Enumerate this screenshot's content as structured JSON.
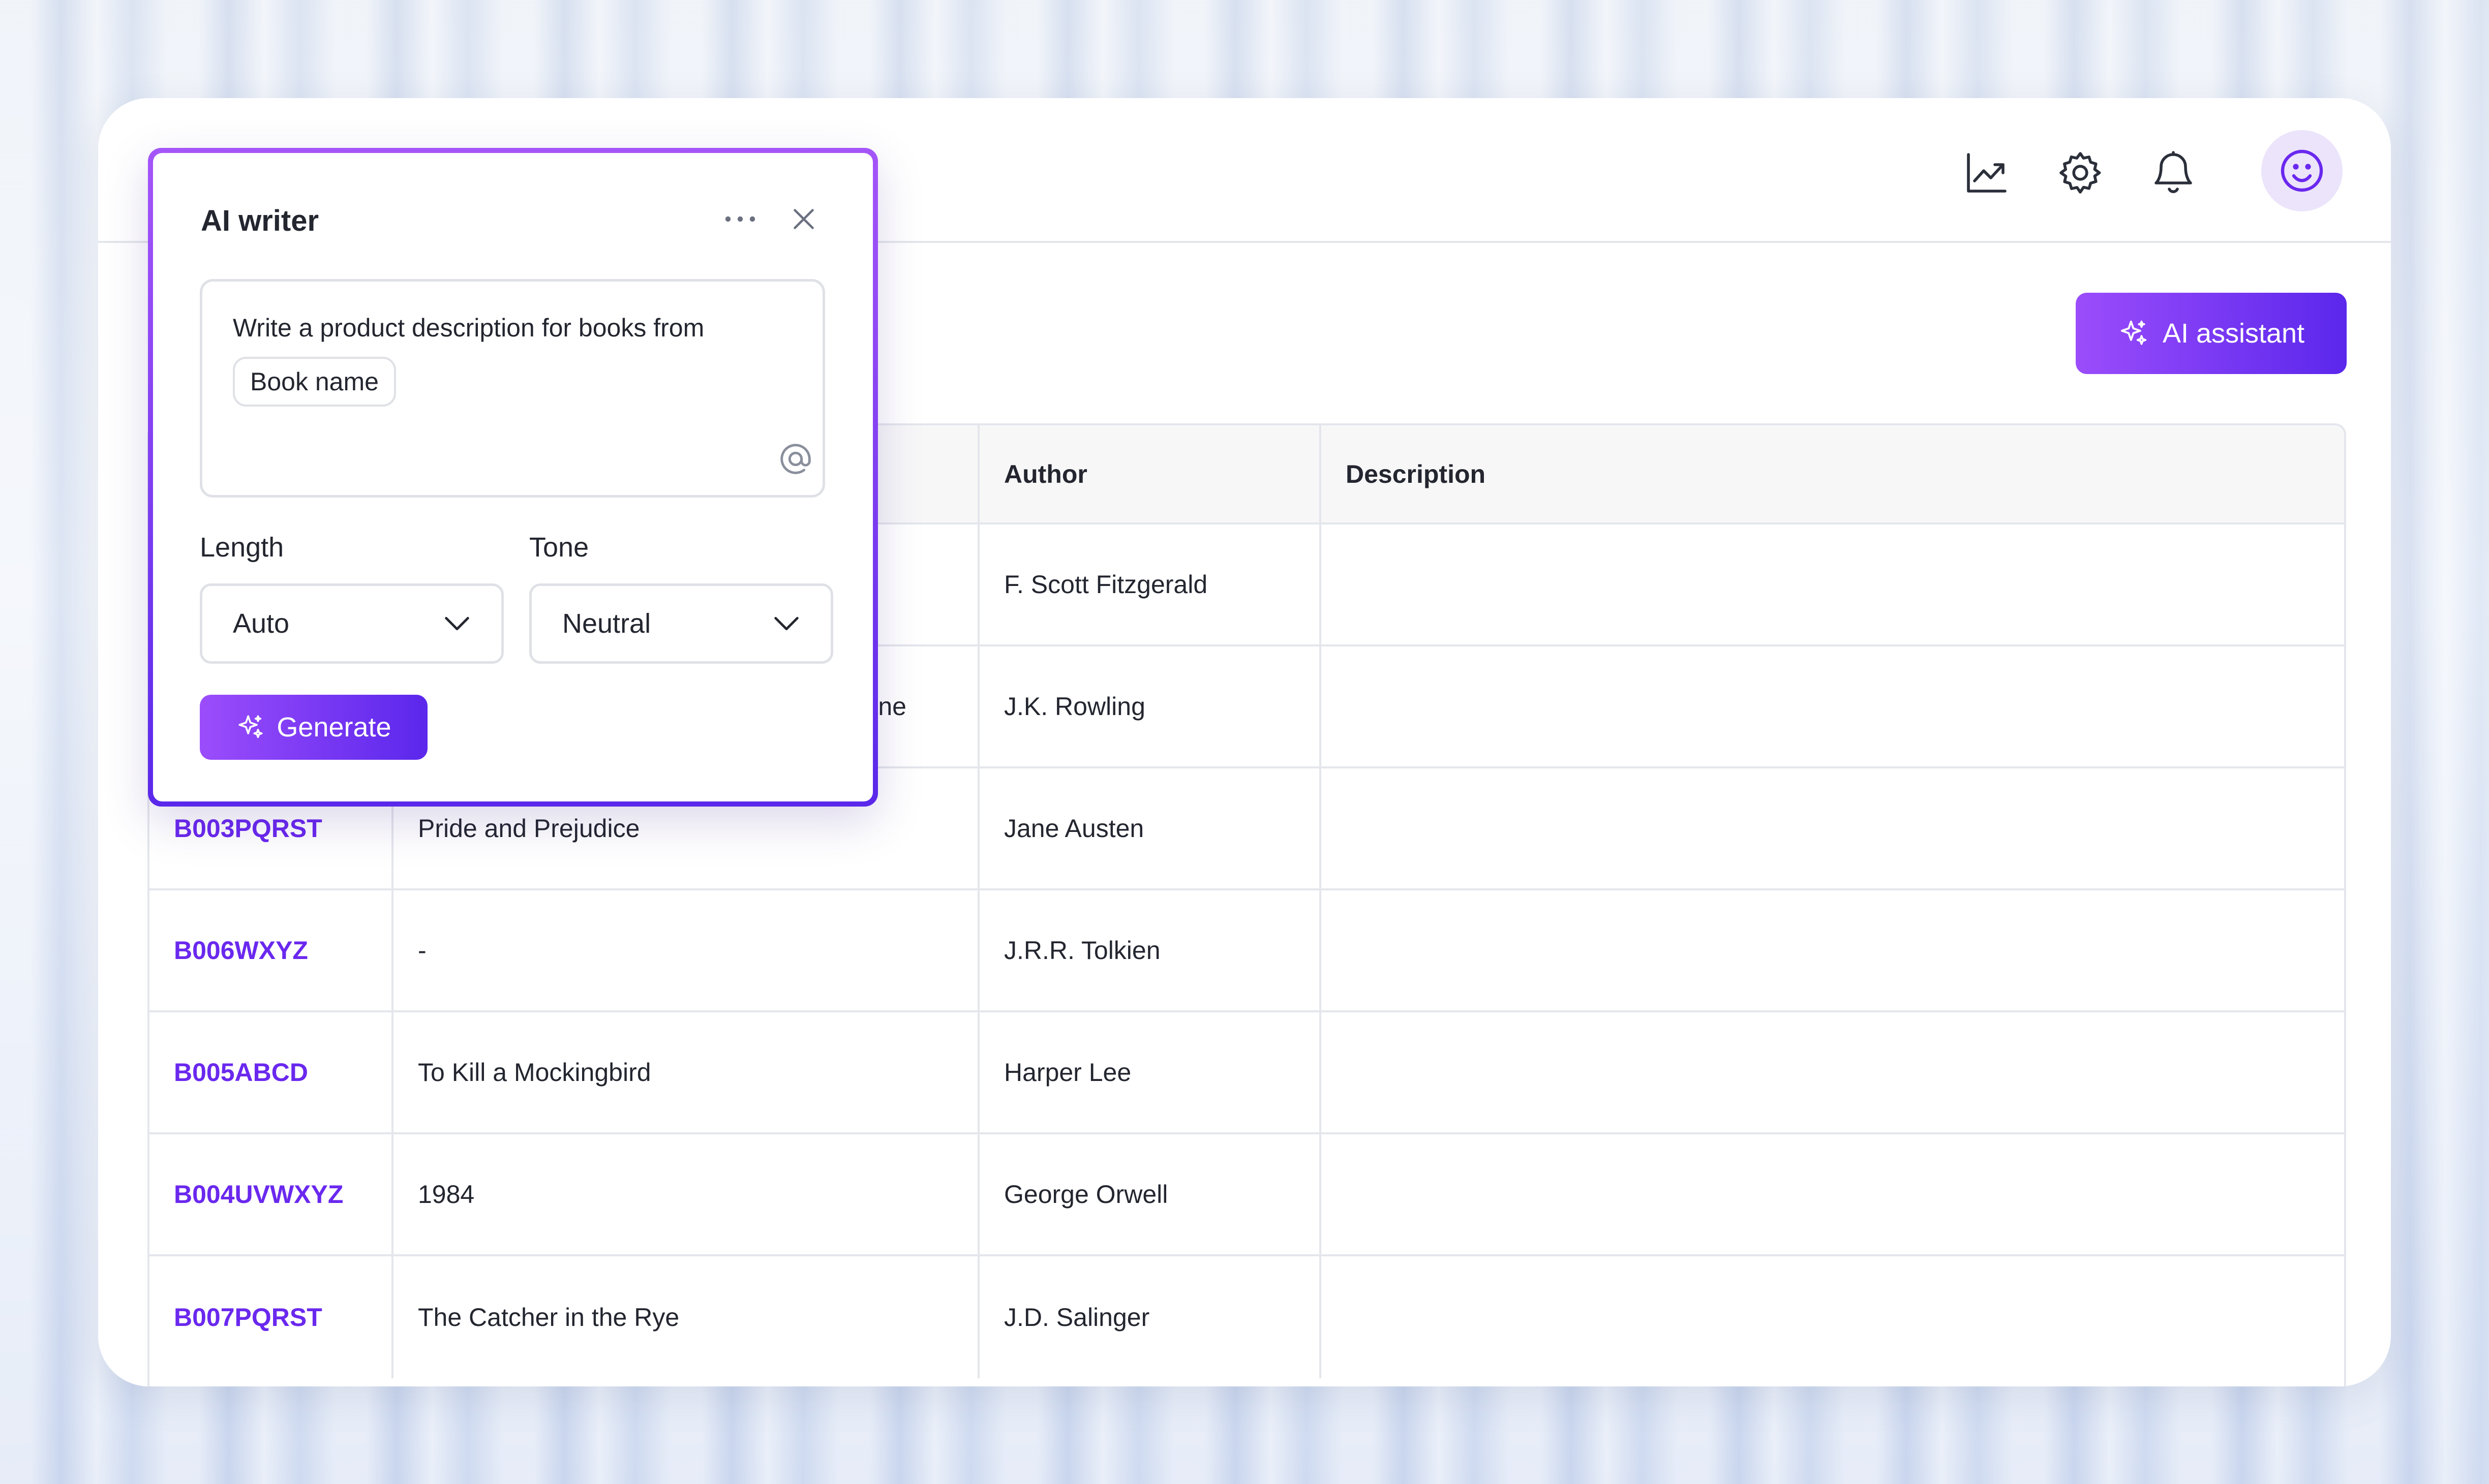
{
  "header": {
    "icons": [
      "chart-icon",
      "gear-icon",
      "bell-icon",
      "smiley-avatar-icon"
    ]
  },
  "toolbar": {
    "ai_assistant_label": "AI assistant"
  },
  "table": {
    "columns": [
      "",
      "",
      "Author",
      "Description"
    ],
    "rows": [
      {
        "id": "",
        "title": "",
        "author": "F. Scott Fitzgerald",
        "description": ""
      },
      {
        "id": "",
        "title": "ne",
        "author": "J.K. Rowling",
        "description": ""
      },
      {
        "id": "B003PQRST",
        "title": "Pride and Prejudice",
        "author": "Jane Austen",
        "description": ""
      },
      {
        "id": "B006WXYZ",
        "title": "-",
        "author": "J.R.R. Tolkien",
        "description": ""
      },
      {
        "id": "B005ABCD",
        "title": "To Kill a Mockingbird",
        "author": "Harper Lee",
        "description": ""
      },
      {
        "id": "B004UVWXYZ",
        "title": "1984",
        "author": "George Orwell",
        "description": ""
      },
      {
        "id": "B007PQRST",
        "title": "The Catcher in the Rye",
        "author": "J.D. Salinger",
        "description": ""
      }
    ]
  },
  "ai_writer": {
    "title": "AI writer",
    "prompt_text": "Write a product description for books from",
    "prompt_chip": "Book name",
    "length_label": "Length",
    "length_value": "Auto",
    "tone_label": "Tone",
    "tone_value": "Neutral",
    "generate_label": "Generate"
  },
  "colors": {
    "accent": "#6a28ee",
    "gradient_start": "#9b4dfb",
    "gradient_end": "#5b27ec",
    "avatar_bg": "#ece4fb"
  }
}
